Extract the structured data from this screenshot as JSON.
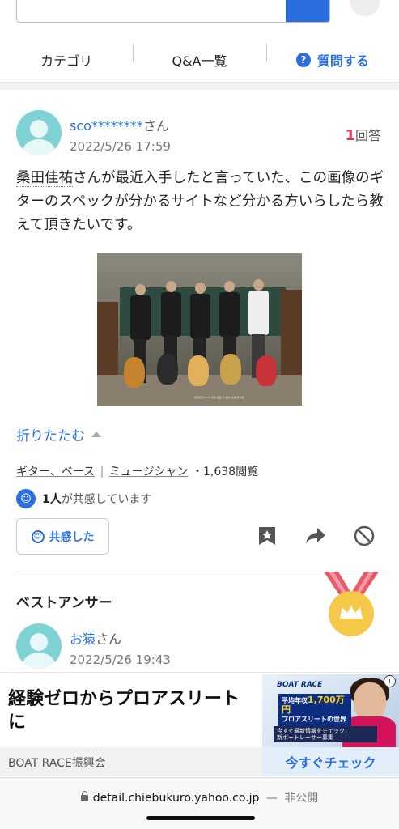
{
  "tabs": {
    "category": "カテゴリ",
    "qa_list": "Q&A一覧",
    "ask": "質問する",
    "ask_icon": "?"
  },
  "question": {
    "user": "sco********",
    "honorific": "さん",
    "date": "2022/5/26 17:59",
    "answer_count": "1",
    "answer_label": "回答",
    "body_highlight": "桑田佳祐",
    "body_rest": "さんが最近入手したと言っていた、この画像のギターのスペックが分かるサイトなど分かる方いらしたら教えて頂きたいです。",
    "collapse_label": "折りたたむ",
    "categories": [
      "ギター、ベース",
      "ミュージシャン"
    ],
    "category_sep": "|",
    "views": "・1,638閲覧",
    "empathy_count": "1人",
    "empathy_text": "が共感しています",
    "empathy_button": "共感した",
    "photo_caption": "御尾和田 Ross 音楽 製品 元 記念 社長 著作権"
  },
  "best_answer": {
    "title": "ベストアンサー",
    "user": "お猿",
    "honorific": "さん",
    "date": "2022/5/26 19:43"
  },
  "ad": {
    "headline": "経験ゼロからプロアスリートに",
    "brand": "BOAT RACE",
    "copy_line1": "平均年収",
    "copy_amount": "1,700万円",
    "copy_line2": "プロアスリートの世界へ",
    "strip_line1": "今すぐ最新情報をチェック!",
    "strip_line2": "新ボートレーサー募集",
    "info_icon": "i",
    "sponsor": "BOAT RACE振興会",
    "cta": "今すぐチェック"
  },
  "browser": {
    "url": "detail.chiebukuro.yahoo.co.jp",
    "separator": "—",
    "visibility": "非公開"
  },
  "colors": {
    "accent": "#2b6ee0",
    "answer_count": "#e0384e",
    "avatar": "#7fd2d3",
    "medal_gold": "#f5c84a",
    "medal_ribbon": "#e85a6a"
  }
}
